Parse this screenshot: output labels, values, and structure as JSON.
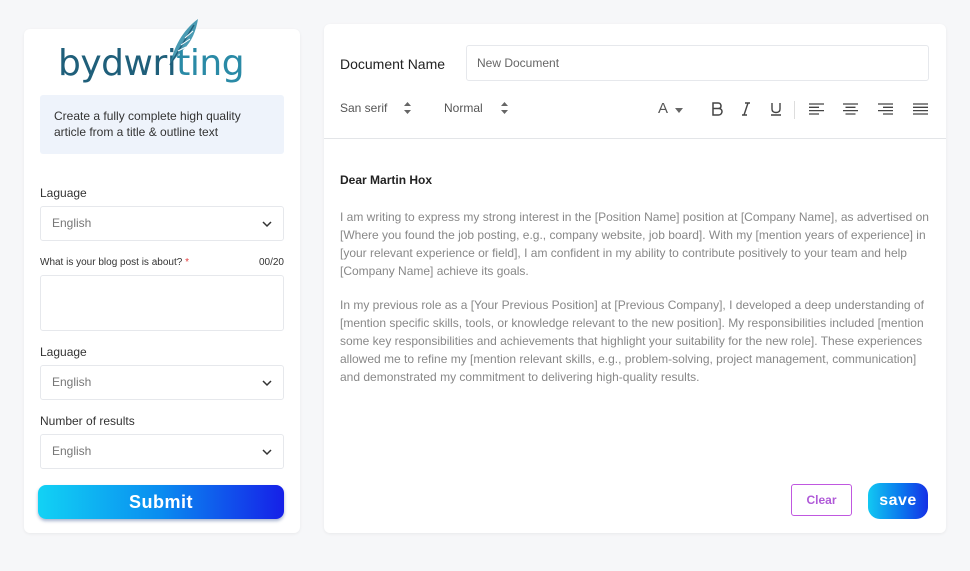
{
  "sidebar": {
    "logo_text_a": "bydwri",
    "logo_text_b": "ting",
    "promo_text": "Create a fully complete high quality  article from a title & outline text",
    "language_label": "Laguage",
    "language_value": "English",
    "topic_label": "What is your blog post is about?",
    "topic_required": "*",
    "topic_counter": "00/20",
    "language2_label": "Laguage",
    "language2_value": "English",
    "results_label": "Number of results",
    "results_value": "English",
    "submit_label": "Submit"
  },
  "document": {
    "name_label": "Document Name",
    "name_placeholder": "New Document",
    "toolbar": {
      "font_family": "San serif",
      "font_size": "Normal",
      "color_letter": "A"
    },
    "greeting": "Dear Martin Hox",
    "paragraphs": [
      "I am writing to express my strong interest in the [Position Name] position at [Company Name], as advertised on [Where you found the job posting, e.g., company website, job board]. With my [mention years of experience] in [your relevant experience or field], I am confident in my ability to contribute positively to your team and help [Company Name] achieve its goals.",
      "In my previous role as a [Your Previous Position] at [Previous Company], I developed a deep understanding of [mention specific skills, tools, or knowledge relevant to the new position]. My responsibilities included [mention some key responsibilities and achievements that highlight your suitability for the new role]. These experiences allowed me to refine my [mention relevant skills, e.g., problem-solving, project management, communication] and demonstrated my commitment to delivering high-quality results."
    ],
    "clear_label": "Clear",
    "save_label": "save"
  },
  "colors": {
    "accent_blue": "#0a8cf0",
    "clear_border": "#c058e0",
    "logo": "#1f5f7a"
  },
  "icons": [
    "feather-icon",
    "chevron-down-icon",
    "sort-icon",
    "bold-icon",
    "italic-icon",
    "underline-icon",
    "align-left-icon",
    "align-center-icon",
    "align-right-icon",
    "align-justify-icon"
  ]
}
